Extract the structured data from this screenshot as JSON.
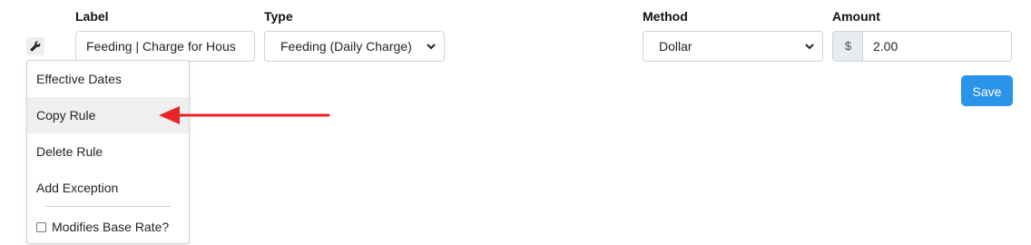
{
  "headers": {
    "label": "Label",
    "type": "Type",
    "method": "Method",
    "amount": "Amount"
  },
  "label_field": {
    "value": "Feeding | Charge for Hous"
  },
  "type_select": {
    "selected": "Feeding (Daily Charge)"
  },
  "method_select": {
    "selected": "Dollar"
  },
  "amount": {
    "prefix": "$",
    "value": "2.00"
  },
  "rule_menu": {
    "icon": "wrench-icon",
    "items": [
      {
        "label": "Effective Dates"
      },
      {
        "label": "Copy Rule"
      },
      {
        "label": "Delete Rule"
      },
      {
        "label": "Add Exception"
      }
    ],
    "checkbox_label": "Modifies Base Rate?",
    "checkbox_checked": false,
    "highlighted_item": "Copy Rule"
  },
  "save_label": "Save",
  "colors": {
    "accent": "#2a93ea",
    "annotation_arrow": "#e8232a",
    "menu_highlight": "#efefef"
  }
}
